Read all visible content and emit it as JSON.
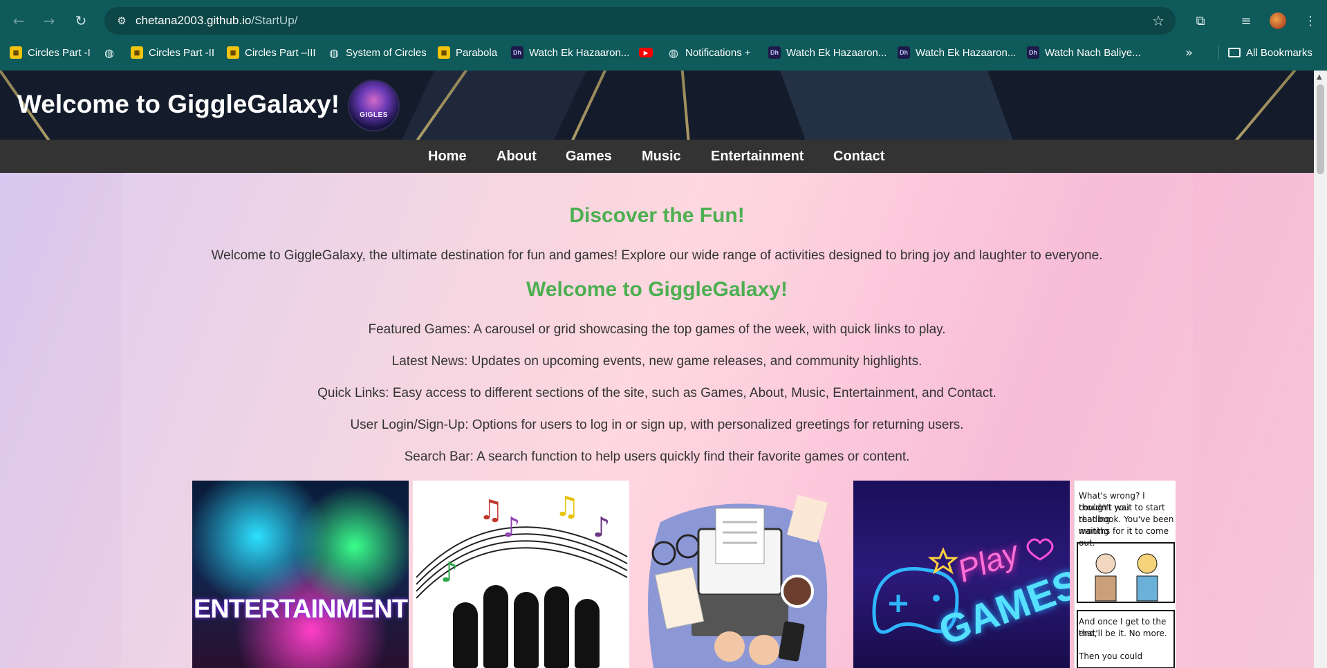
{
  "browser": {
    "url_host": "chetana2003.github.io",
    "url_path": "/StartUp/",
    "bookmarks": [
      {
        "label": "Circles Part -I",
        "icon": "yellow-book-icon"
      },
      {
        "label": "",
        "icon": "globe-icon"
      },
      {
        "label": "Circles Part -II",
        "icon": "yellow-book-icon"
      },
      {
        "label": "Circles Part –III",
        "icon": "yellow-book-icon"
      },
      {
        "label": "System of Circles",
        "icon": "globe-icon"
      },
      {
        "label": "Parabola",
        "icon": "yellow-book-icon"
      },
      {
        "label": "Watch Ek Hazaaron...",
        "icon": "hotstar-icon"
      },
      {
        "label": "",
        "icon": "youtube-icon"
      },
      {
        "label": "Notifications +",
        "icon": "globe-icon"
      },
      {
        "label": "Watch Ek Hazaaron...",
        "icon": "hotstar-icon"
      },
      {
        "label": "Watch Ek Hazaaron...",
        "icon": "hotstar-icon"
      },
      {
        "label": "Watch Nach Baliye...",
        "icon": "hotstar-icon"
      }
    ],
    "all_bookmarks": "All Bookmarks"
  },
  "site": {
    "title": "Welcome to GiggleGalaxy!",
    "logo_text": "GIGLES",
    "nav": [
      "Home",
      "About",
      "Games",
      "Music",
      "Entertainment",
      "Contact"
    ]
  },
  "main": {
    "heading": "Discover the Fun!",
    "intro": "Welcome to GiggleGalaxy, the ultimate destination for fun and games! Explore our wide range of activities designed to bring joy and laughter to everyone.",
    "heading2": "Welcome to GiggleGalaxy!",
    "features": [
      "Featured Games: A carousel or grid showcasing the top games of the week, with quick links to play.",
      "Latest News: Updates on upcoming events, new game releases, and community highlights.",
      "Quick Links: Easy access to different sections of the site, such as Games, About, Music, Entertainment, and Contact.",
      "User Login/Sign-Up: Options for users to log in or sign up, with personalized greetings for returning users.",
      "Search Bar: A search function to help users quickly find their favorite games or content."
    ],
    "tiles": {
      "entertainment_label": "ENTERTAINMENT",
      "games_play": "Play",
      "games_label": "GAMES",
      "comic_lines": [
        "What's wrong? I thought you",
        "couldn't wait to start reading",
        "that book. You've been waiting",
        "months for it to come out.",
        "And once I get to the end,",
        "that'll be it. No more.",
        "Then you could"
      ]
    }
  },
  "colors": {
    "chrome": "#0f5a5a",
    "heading_green": "#4caf50",
    "nav_bar": "#333333",
    "header_bg": "#141c2b"
  }
}
